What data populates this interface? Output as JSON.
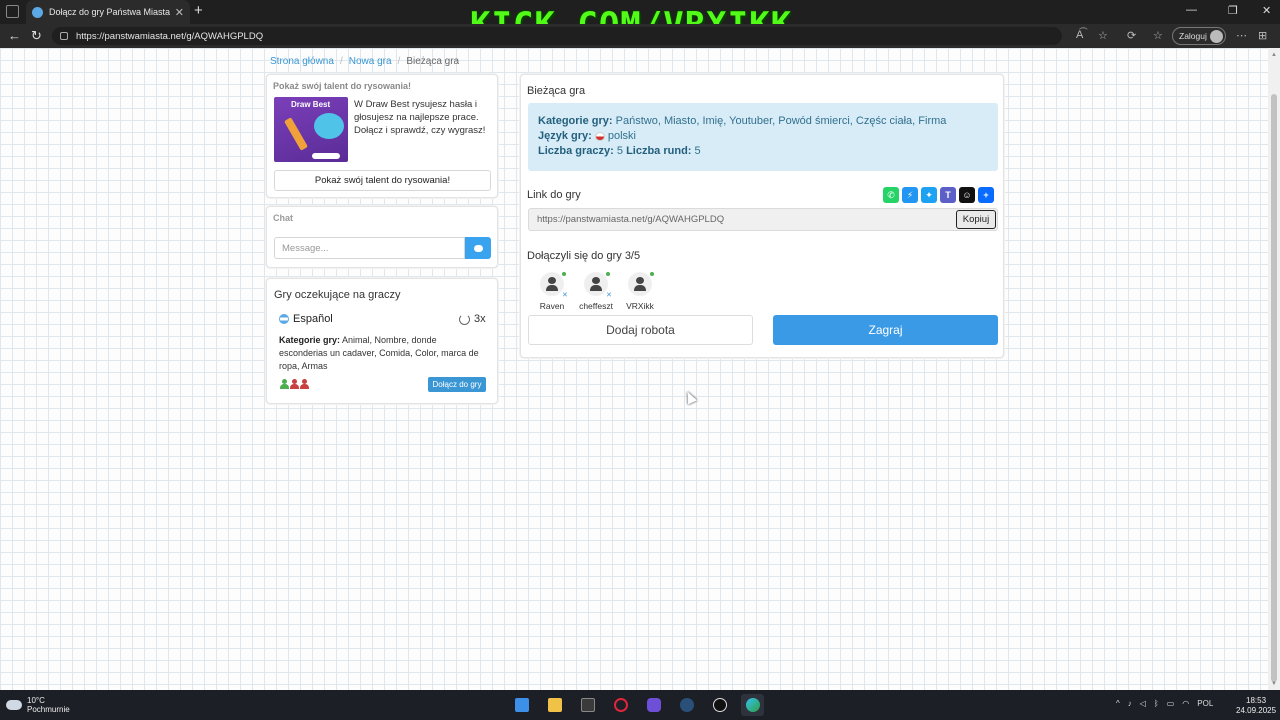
{
  "browser": {
    "tab_title": "Dołącz do gry Państwa Miasta",
    "tab_close": "✕",
    "new_tab": "+",
    "url": "https://panstwamiasta.net/g/AQWAHGPLDQ",
    "login_label": "Zaloguj",
    "window_controls": [
      "—",
      "❐",
      "✕"
    ],
    "back": "←",
    "refresh": "↻",
    "addr_icons": [
      "A͡",
      "☆",
      "⟳",
      "☆",
      "⊞"
    ],
    "menu": "⋯"
  },
  "overlay": {
    "text": "KICK.COM/VRXIKK",
    "color": "#53fc18"
  },
  "breadcrumb": {
    "home": "Strona główna",
    "new_game": "Nowa gra",
    "current": "Bieżąca gra"
  },
  "promo": {
    "title": "Pokaż swój talent do rysowania!",
    "image_brand": "Draw Best",
    "text": "W Draw Best rysujesz hasła i głosujesz na najlepsze prace. Dołącz i sprawdź, czy wygrasz!",
    "button": "Pokaż swój talent do rysowania!"
  },
  "chat": {
    "title": "Chat",
    "placeholder": "Message..."
  },
  "waiting_games": {
    "title": "Gry oczekujące na graczy",
    "language": "Español",
    "rounds": "3x",
    "categories_label": "Kategorie gry:",
    "categories": "Animal, Nombre, donde esconderias un cadaver, Comida, Color, marca de ropa, Armas",
    "player_colors": [
      "#4caf50",
      "#c94040",
      "#c94040"
    ],
    "join_button": "Dołącz do gry"
  },
  "current_game": {
    "title": "Bieżąca gra",
    "categories_label": "Kategorie gry:",
    "categories": "Państwo, Miasto, Imię, Youtuber, Powód śmierci, Częśc ciała, Firma",
    "language_label": "Język gry:",
    "language": "polski",
    "players_label": "Liczba graczy:",
    "players_count": "5",
    "rounds_label": "Liczba rund:",
    "rounds_count": "5",
    "link_label": "Link do gry",
    "share_buttons": [
      {
        "name": "whatsapp-icon",
        "color": "#25d366",
        "glyph": "✆"
      },
      {
        "name": "messenger-icon",
        "color": "#2196f3",
        "glyph": "⚡"
      },
      {
        "name": "twitter-icon",
        "color": "#1da1f2",
        "glyph": "✦"
      },
      {
        "name": "teams-icon",
        "color": "#5b5fc7",
        "glyph": "T"
      },
      {
        "name": "snapchat-icon",
        "color": "#111111",
        "glyph": "☺"
      },
      {
        "name": "share-plus-icon",
        "color": "#0a6cff",
        "glyph": "+"
      }
    ],
    "link": "https://panstwamiasta.net/g/AQWAHGPLDQ",
    "copy_button": "Kopiuj",
    "joined_label": "Dołączyli się do gry 3/5",
    "players": [
      "Raven",
      "cheffeszt",
      "VRXikk"
    ],
    "add_robot_button": "Dodaj robota",
    "play_button": "Zagraj"
  },
  "taskbar": {
    "temperature": "10°C",
    "weather": "Pochmurnie",
    "language": "POL",
    "time": "18:53",
    "date": "24.09.2025"
  }
}
